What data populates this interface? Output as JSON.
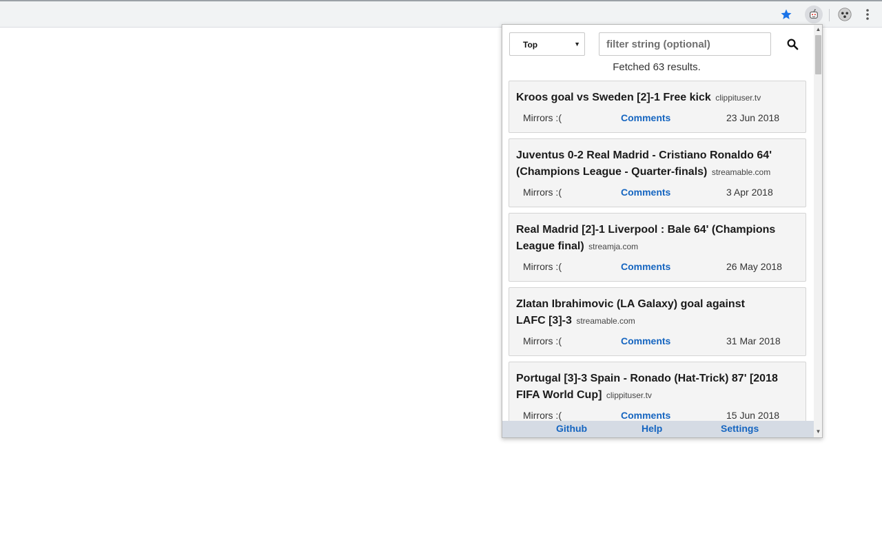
{
  "toolbar": {
    "icons": [
      "star-icon",
      "reddit-extension-icon",
      "avatar-icon",
      "menu-kebab-icon"
    ]
  },
  "popup": {
    "sort": {
      "selected": "Top"
    },
    "filter": {
      "placeholder": "filter string (optional)",
      "value": ""
    },
    "status": "Fetched 63 results.",
    "mirrors_label": "Mirrors :(",
    "comments_label": "Comments",
    "results": [
      {
        "title": "Kroos goal vs Sweden [2]-1 Free kick",
        "domain": "clippituser.tv",
        "date": "23 Jun 2018"
      },
      {
        "title": "Juventus 0-2 Real Madrid - Cristiano Ronaldo 64' (Champions League - Quarter-finals)",
        "domain": "streamable.com",
        "date": "3 Apr 2018"
      },
      {
        "title": "Real Madrid [2]-1 Liverpool : Bale 64' (Champions League final)",
        "domain": "streamja.com",
        "date": "26 May 2018"
      },
      {
        "title": "Zlatan Ibrahimovic (LA Galaxy) goal against LAFC [3]-3",
        "domain": "streamable.com",
        "date": "31 Mar 2018"
      },
      {
        "title": "Portugal [3]-3 Spain - Ronado (Hat-Trick) 87' [2018 FIFA World Cup]",
        "domain": "clippituser.tv",
        "date": "15 Jun 2018"
      }
    ],
    "footer": {
      "github": "Github",
      "help": "Help",
      "settings": "Settings"
    }
  },
  "colors": {
    "link": "#1565c0",
    "footer_bg": "#d5dbe4",
    "card_bg": "#f4f4f4",
    "star": "#1a73e8"
  }
}
